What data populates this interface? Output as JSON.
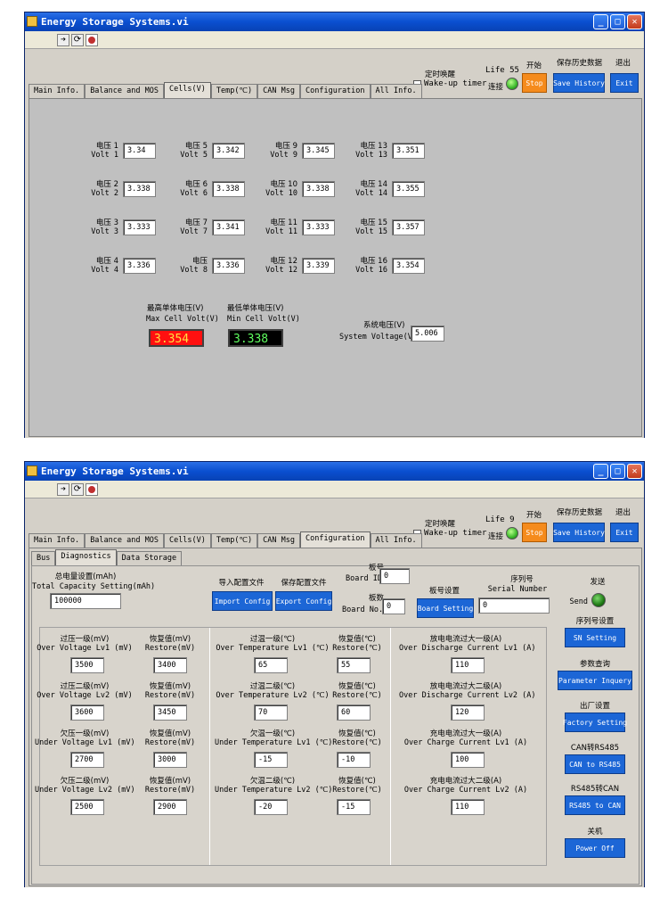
{
  "window1": {
    "title": "Energy Storage Systems.vi",
    "header": {
      "wake_cn": "定时唤醒",
      "wake_label": "Wake-up timer",
      "life_label": "Life",
      "life_value": "55",
      "connect_cn": "连接",
      "start_cn": "开始",
      "stop_label": "Stop",
      "save_cn": "保存历史数据",
      "save_label": "Save History",
      "exit_cn": "退出",
      "exit_label": "Exit"
    },
    "tabs": [
      "Main Info.",
      "Balance and MOS",
      "Cells(V)",
      "Temp(℃)",
      "CAN Msg",
      "Configuration",
      "All Info."
    ],
    "active_tab": "Cells(V)",
    "cells": [
      {
        "cn": "电压 1",
        "en": "Volt 1",
        "value": "3.34"
      },
      {
        "cn": "电压 2",
        "en": "Volt 2",
        "value": "3.338"
      },
      {
        "cn": "电压 3",
        "en": "Volt 3",
        "value": "3.333"
      },
      {
        "cn": "电压 4",
        "en": "Volt 4",
        "value": "3.336"
      },
      {
        "cn": "电压 5",
        "en": "Volt 5",
        "value": "3.342"
      },
      {
        "cn": "电压 6",
        "en": "Volt 6",
        "value": "3.338"
      },
      {
        "cn": "电压 7",
        "en": "Volt 7",
        "value": "3.341"
      },
      {
        "cn": "电压",
        "en": "Volt 8",
        "value": "3.336"
      },
      {
        "cn": "电压 9",
        "en": "Volt 9",
        "value": "3.345"
      },
      {
        "cn": "电压 10",
        "en": "Volt 10",
        "value": "3.338"
      },
      {
        "cn": "电压 11",
        "en": "Volt 11",
        "value": "3.333"
      },
      {
        "cn": "电压 12",
        "en": "Volt 12",
        "value": "3.339"
      },
      {
        "cn": "电压 13",
        "en": "Volt 13",
        "value": "3.351"
      },
      {
        "cn": "电压 14",
        "en": "Volt 14",
        "value": "3.355"
      },
      {
        "cn": "电压 15",
        "en": "Volt 15",
        "value": "3.357"
      },
      {
        "cn": "电压 16",
        "en": "Volt 16",
        "value": "3.354"
      }
    ],
    "max_cn": "最高单体电压(V)",
    "max_en": "Max Cell Volt(V)",
    "max_value": "3.354",
    "min_cn": "最低单体电压(V)",
    "min_en": "Min Cell Volt(V)",
    "min_value": "3.338",
    "sys_cn": "系统电压(V)",
    "sys_en": "System Voltage(V)",
    "sys_value": "5.006"
  },
  "window2": {
    "title": "Energy Storage Systems.vi",
    "header": {
      "wake_cn": "定时唤醒",
      "wake_label": "Wake-up timer",
      "life_label": "Life",
      "life_value": "9",
      "connect_cn": "连接",
      "start_cn": "开始",
      "stop_label": "Stop",
      "save_cn": "保存历史数据",
      "save_label": "Save History",
      "exit_cn": "退出",
      "exit_label": "Exit"
    },
    "tabs": [
      "Main Info.",
      "Balance and MOS",
      "Cells(V)",
      "Temp(℃)",
      "CAN Msg",
      "Configuration",
      "All Info."
    ],
    "active_tab": "Configuration",
    "subtabs": [
      "Bus",
      "Diagnostics",
      "Data Storage"
    ],
    "active_subtab": "Diagnostics",
    "capacity_cn": "总电量设置(mAh)",
    "capacity_en": "Total Capacity Setting(mAh)",
    "capacity_value": "100000",
    "import_cn": "导入配置文件",
    "import_label": "Import Config",
    "export_cn": "保存配置文件",
    "export_label": "Export Config",
    "board_id_cn": "板号",
    "board_id_en": "Board ID",
    "board_id_value": "0",
    "board_no_cn": "板数",
    "board_no_en": "Board No.",
    "board_no_value": "0",
    "board_setting_cn": "板号设置",
    "board_setting_label": "Board Setting",
    "serial_cn": "序列号",
    "serial_en": "Serial Number",
    "serial_value": "0",
    "send_cn": "发送",
    "send_label": "Send",
    "col1": [
      {
        "cn": "过压一级(mV)",
        "en": "Over Voltage Lv1 (mV)",
        "value": "3500",
        "r_cn": "恢复值(mV)",
        "r_en": "Restore(mV)",
        "r_value": "3400"
      },
      {
        "cn": "过压二级(mV)",
        "en": "Over Voltage Lv2 (mV)",
        "value": "3600",
        "r_cn": "恢复值(mV)",
        "r_en": "Restore(mV)",
        "r_value": "3450"
      },
      {
        "cn": "欠压一级(mV)",
        "en": "Under Voltage Lv1 (mV)",
        "value": "2700",
        "r_cn": "恢复值(mV)",
        "r_en": "Restore(mV)",
        "r_value": "3000"
      },
      {
        "cn": "欠压二级(mV)",
        "en": "Under Voltage Lv2 (mV)",
        "value": "2500",
        "r_cn": "恢复值(mV)",
        "r_en": "Restore(mV)",
        "r_value": "2900"
      }
    ],
    "col2": [
      {
        "cn": "过温一级(℃)",
        "en": "Over Temperature Lv1 (℃)",
        "value": "65",
        "r_cn": "恢复值(℃)",
        "r_en": "Restore(℃)",
        "r_value": "55"
      },
      {
        "cn": "过温二级(℃)",
        "en": "Over Temperature Lv2 (℃)",
        "value": "70",
        "r_cn": "恢复值(℃)",
        "r_en": "Restore(℃)",
        "r_value": "60"
      },
      {
        "cn": "欠温一级(℃)",
        "en": "Under Temperature Lv1 (℃)",
        "value": "-15",
        "r_cn": "恢复值(℃)",
        "r_en": "Restore(℃)",
        "r_value": "-10"
      },
      {
        "cn": "欠温二级(℃)",
        "en": "Under Temperature Lv2 (℃)",
        "value": "-20",
        "r_cn": "恢复值(℃)",
        "r_en": "Restore(℃)",
        "r_value": "-15"
      }
    ],
    "col3": [
      {
        "cn": "放电电流过大一级(A)",
        "en": "Over Discharge Current Lv1 (A)",
        "value": "110"
      },
      {
        "cn": "放电电流过大二级(A)",
        "en": "Over Discharge Current Lv2 (A)",
        "value": "120"
      },
      {
        "cn": "充电电流过大一级(A)",
        "en": "Over Charge Current Lv1 (A)",
        "value": "100"
      },
      {
        "cn": "充电电流过大二级(A)",
        "en": "Over Charge Current Lv2 (A)",
        "value": "110"
      }
    ],
    "right_buttons": [
      {
        "cn": "序列号设置",
        "label": "SN Setting"
      },
      {
        "cn": "参数查询",
        "label": "Parameter Inquery"
      },
      {
        "cn": "出厂设置",
        "label": "Factory Setting"
      },
      {
        "cn": "CAN转RS485",
        "label": "CAN to RS485"
      },
      {
        "cn": "RS485转CAN",
        "label": "RS485 to CAN"
      },
      {
        "cn": "关机",
        "label": "Power Off"
      }
    ]
  }
}
